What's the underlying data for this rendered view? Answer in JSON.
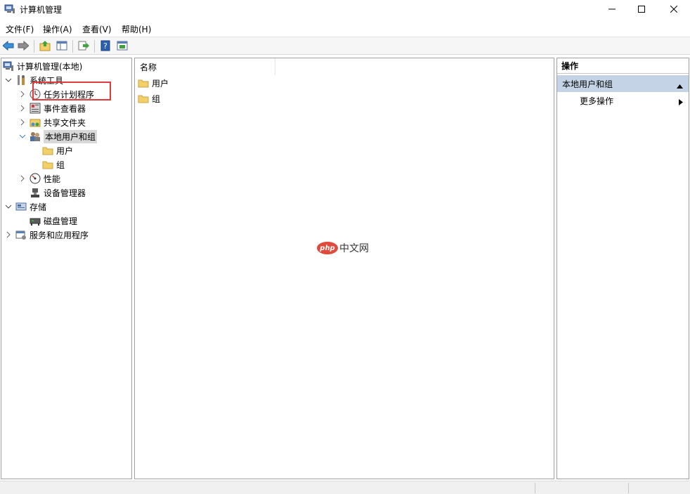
{
  "window": {
    "title": "计算机管理",
    "controls": [
      "minimize-icon",
      "maximize-icon",
      "close-icon"
    ]
  },
  "menu": [
    {
      "label": "文件(F)"
    },
    {
      "label": "操作(A)"
    },
    {
      "label": "查看(V)"
    },
    {
      "label": "帮助(H)"
    }
  ],
  "toolbar": {
    "buttons": [
      "back-arrow-icon",
      "forward-arrow-icon",
      "up-folder-icon",
      "show-hide-tree-icon",
      "export-list-icon",
      "help-icon",
      "show-hide-action-pane-icon"
    ]
  },
  "tree": {
    "root": "计算机管理(本地)",
    "system_tools": "系统工具",
    "task_scheduler": "任务计划程序",
    "event_viewer": "事件查看器",
    "shared_folders": "共享文件夹",
    "local_users_groups": "本地用户和组",
    "users": "用户",
    "groups": "组",
    "performance": "性能",
    "device_manager": "设备管理器",
    "storage": "存储",
    "disk_management": "磁盘管理",
    "services_apps": "服务和应用程序"
  },
  "list": {
    "column_name": "名称",
    "items": [
      {
        "label": "用户"
      },
      {
        "label": "组"
      }
    ]
  },
  "watermark": {
    "logo": "php",
    "text": "中文网"
  },
  "actions": {
    "header": "操作",
    "section": "本地用户和组",
    "more": "更多操作"
  },
  "colors": {
    "section_bg": "#c4d4e6",
    "highlight_border": "#e03a3a",
    "folder": "#f3cf6a"
  }
}
